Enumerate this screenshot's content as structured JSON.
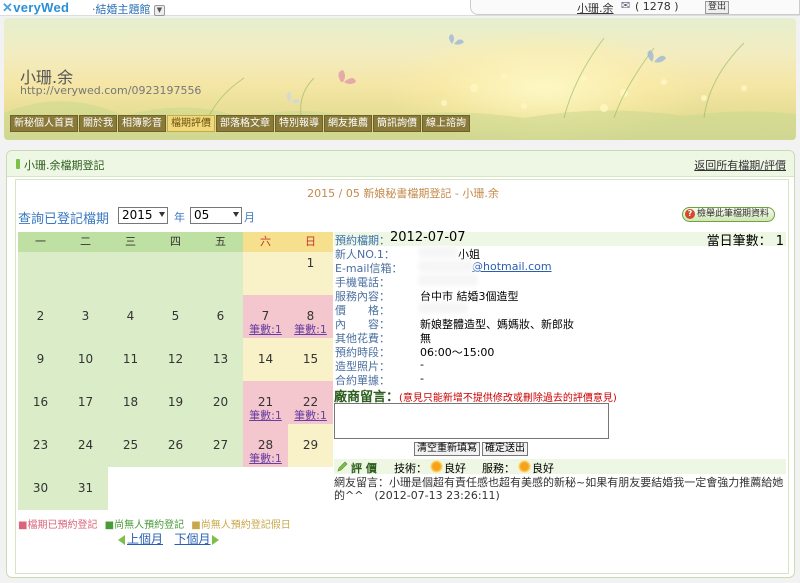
{
  "topbar": {
    "logo": "veryWed",
    "theme_label": "結婚主題館",
    "user_name": "小珊.余",
    "mail_count": "( 1278 )",
    "logout": "登出"
  },
  "banner": {
    "site_name": "小珊.余",
    "site_url": "http://verywed.com/0923197556"
  },
  "nav": {
    "items": [
      "新秘個人首頁",
      "關於我",
      "相簿影音",
      "檔期評價",
      "部落格文章",
      "特別報導",
      "網友推薦",
      "簡訊詢價",
      "線上諮詢"
    ],
    "active_index": 3
  },
  "panel": {
    "title": "小珊.余檔期登記",
    "back_link": "返回所有檔期/評價",
    "heading": "2015 / 05 新娘秘書檔期登記 - 小珊.余"
  },
  "query": {
    "label": "查詢已登記檔期",
    "year": "2015",
    "year_unit": "年",
    "month": "05",
    "month_unit": "月",
    "check_button": "檢舉此筆檔期資料"
  },
  "calendar": {
    "weekdays": [
      "一",
      "二",
      "三",
      "四",
      "五",
      "六",
      "日"
    ],
    "days": [
      {
        "d": "1",
        "col": 6,
        "row": 0
      },
      {
        "d": "2",
        "col": 0,
        "row": 1
      },
      {
        "d": "3",
        "col": 1,
        "row": 1
      },
      {
        "d": "4",
        "col": 2,
        "row": 1
      },
      {
        "d": "5",
        "col": 3,
        "row": 1
      },
      {
        "d": "6",
        "col": 4,
        "row": 1
      },
      {
        "d": "7",
        "col": 5,
        "row": 1,
        "booked": true,
        "count": "筆數:1"
      },
      {
        "d": "8",
        "col": 6,
        "row": 1,
        "booked": true,
        "count": "筆數:1"
      },
      {
        "d": "9",
        "col": 0,
        "row": 2
      },
      {
        "d": "10",
        "col": 1,
        "row": 2
      },
      {
        "d": "11",
        "col": 2,
        "row": 2
      },
      {
        "d": "12",
        "col": 3,
        "row": 2
      },
      {
        "d": "13",
        "col": 4,
        "row": 2
      },
      {
        "d": "14",
        "col": 5,
        "row": 2
      },
      {
        "d": "15",
        "col": 6,
        "row": 2
      },
      {
        "d": "16",
        "col": 0,
        "row": 3
      },
      {
        "d": "17",
        "col": 1,
        "row": 3
      },
      {
        "d": "18",
        "col": 2,
        "row": 3
      },
      {
        "d": "19",
        "col": 3,
        "row": 3
      },
      {
        "d": "20",
        "col": 4,
        "row": 3
      },
      {
        "d": "21",
        "col": 5,
        "row": 3,
        "booked": true,
        "count": "筆數:1"
      },
      {
        "d": "22",
        "col": 6,
        "row": 3,
        "booked": true,
        "count": "筆數:1"
      },
      {
        "d": "23",
        "col": 0,
        "row": 4
      },
      {
        "d": "24",
        "col": 1,
        "row": 4
      },
      {
        "d": "25",
        "col": 2,
        "row": 4
      },
      {
        "d": "26",
        "col": 3,
        "row": 4
      },
      {
        "d": "27",
        "col": 4,
        "row": 4
      },
      {
        "d": "28",
        "col": 5,
        "row": 4,
        "booked": true,
        "count": "筆數:1"
      },
      {
        "d": "29",
        "col": 6,
        "row": 4
      },
      {
        "d": "30",
        "col": 0,
        "row": 5
      },
      {
        "d": "31",
        "col": 1,
        "row": 5
      }
    ]
  },
  "legend": {
    "booked": "■檔期已預約登記",
    "open": "■尚無人預約登記",
    "open_holiday": "■尚無人預約登記假日"
  },
  "month_nav": {
    "prev": "上個月",
    "next": "下個月"
  },
  "detail": {
    "date_label": "預約檔期：",
    "date": "2012-07-07",
    "day_count": "當日筆數： 1",
    "fields": [
      {
        "label": "新人NO.1：",
        "value": "小姐"
      },
      {
        "label": "E-mail信箱：",
        "value": "@hotmail.com"
      },
      {
        "label": "手機電話：",
        "value": ""
      },
      {
        "label": "服務內容：",
        "value": "台中市 結婚3個造型"
      },
      {
        "label": "價　　格：",
        "value": ""
      },
      {
        "label": "內　　容：",
        "value": "新娘整體造型、媽媽妝、新郎妝"
      },
      {
        "label": "其他花費：",
        "value": "無"
      },
      {
        "label": "預約時段：",
        "value": "06:00～15:00"
      },
      {
        "label": "造型照片：",
        "value": "-"
      },
      {
        "label": "合約單據：",
        "value": "-"
      }
    ],
    "merchant_label": "廠商留言：",
    "merchant_note": "(意見只能新增不提供修改或刪除過去的評價意見)",
    "clear_button": "清空重新填寫",
    "submit_button": "確定送出",
    "rating": {
      "label": "評 價",
      "tech_label": "技術：",
      "tech_value": "良好",
      "service_label": "服務：",
      "service_value": "良好"
    },
    "review": "網友留言：小珊是個超有責任感也超有美感的新秘~如果有朋友要結婚我一定會強力推薦給她的^^　(2012-07-13 23:26:11)"
  },
  "colors": {
    "booked": "#f4c7cf",
    "weekday": "#dbedc8",
    "weekend": "#f9f2c9",
    "weekday_head": "#bfe0a3",
    "weekend_head": "#f6e08e"
  }
}
